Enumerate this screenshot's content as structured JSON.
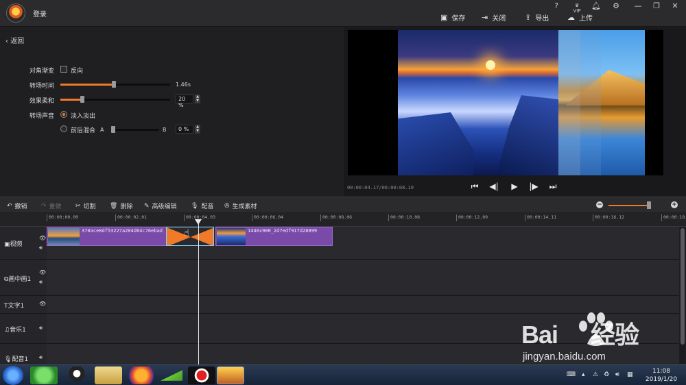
{
  "header": {
    "login": "登录",
    "window_controls": [
      "?",
      "VIP",
      "bell",
      "gear",
      "—",
      "restore",
      "×"
    ],
    "actions": [
      {
        "label": "保存",
        "icon": "save-icon"
      },
      {
        "label": "关闭",
        "icon": "exit-icon"
      },
      {
        "label": "导出",
        "icon": "export-icon"
      },
      {
        "label": "上传",
        "icon": "cloud-upload-icon"
      }
    ]
  },
  "panel": {
    "back": "返回",
    "diagonal_gradient": "对角渐变",
    "reverse": "反向",
    "transition_time": "转场时间",
    "transition_time_value": "1.46s",
    "transition_time_fraction": 0.49,
    "softness": "效果柔和",
    "softness_value": "20 %",
    "softness_fraction": 0.2,
    "transition_audio": "转场声音",
    "fade": "淡入淡出",
    "mix": "前后混合",
    "mix_a": "A",
    "mix_b": "B",
    "mix_value": "0 %"
  },
  "preview": {
    "timecode": "00:00:04.17/00:00:08.19"
  },
  "edit_toolbar": {
    "undo": "撤销",
    "redo": "重做",
    "cut": "切割",
    "delete": "删除",
    "advanced": "高级编辑",
    "dub": "配音",
    "generate": "生成素材",
    "zoom_level": 0.9
  },
  "ruler": [
    "00:00:00.00",
    "00:00:02.01",
    "00:00:04.03",
    "00:00:06.04",
    "00:00:08.06",
    "00:00:10.08",
    "00:00:12.09",
    "00:00:14.11",
    "00:00:16.12",
    "00:00:18.1"
  ],
  "tracks": {
    "video": "视频",
    "pip": "画中画1",
    "text": "文字1",
    "music": "音乐1",
    "dub": "配音1"
  },
  "clips": {
    "clip1": "370ace8df53227a204d64c76ebad",
    "clip2": "1440x900_2d7edf917d28899"
  },
  "watermark": {
    "brand": "Bai",
    "brand2": "经验",
    "url": "jingyan.baidu.com"
  },
  "taskbar": {
    "time": "11:08",
    "date": "2019/1/20"
  }
}
